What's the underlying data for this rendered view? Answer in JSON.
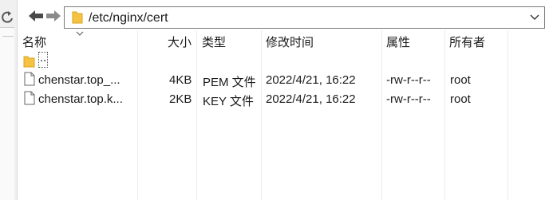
{
  "toolbar": {
    "path": "/etc/nginx/cert"
  },
  "columns": {
    "name": "名称",
    "size": "大小",
    "type": "类型",
    "modified": "修改时间",
    "attributes": "属性",
    "owner": "所有者"
  },
  "parent_dir": {
    "label": ".."
  },
  "files": [
    {
      "name": "chenstar.top_...",
      "size": "4KB",
      "type": "PEM 文件",
      "modified": "2022/4/21, 16:22",
      "attributes": "-rw-r--r--",
      "owner": "root"
    },
    {
      "name": "chenstar.top.k...",
      "size": "2KB",
      "type": "KEY 文件",
      "modified": "2022/4/21, 16:22",
      "attributes": "-rw-r--r--",
      "owner": "root"
    }
  ],
  "colors": {
    "folder": "#f5c242",
    "arrow": "#4a4a4a",
    "border": "#7a7a7a"
  }
}
